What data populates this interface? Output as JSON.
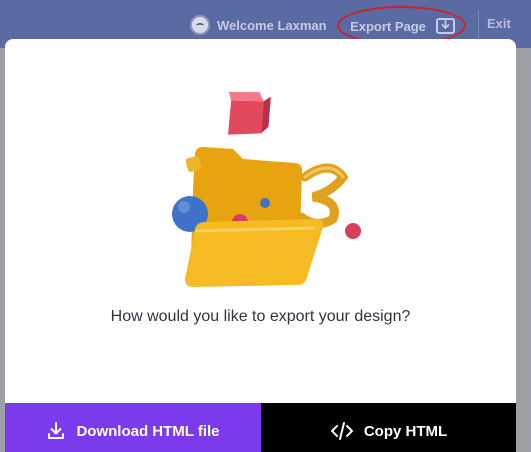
{
  "header": {
    "welcome_text": "Welcome Laxman",
    "subline_text": "",
    "export_label": "Export Page",
    "exit_label": "Exit"
  },
  "modal": {
    "question": "How would you like to export your design?",
    "download_label": "Download HTML file",
    "copy_label": "Copy HTML"
  },
  "colors": {
    "topbar": "#5a6aa2",
    "download_button": "#7c3aed",
    "copy_button": "#000000",
    "annotation": "#d0202a"
  },
  "icons": {
    "avatar": "user-avatar-icon",
    "export": "download-box-icon",
    "download": "download-icon",
    "copy": "code-icon"
  }
}
